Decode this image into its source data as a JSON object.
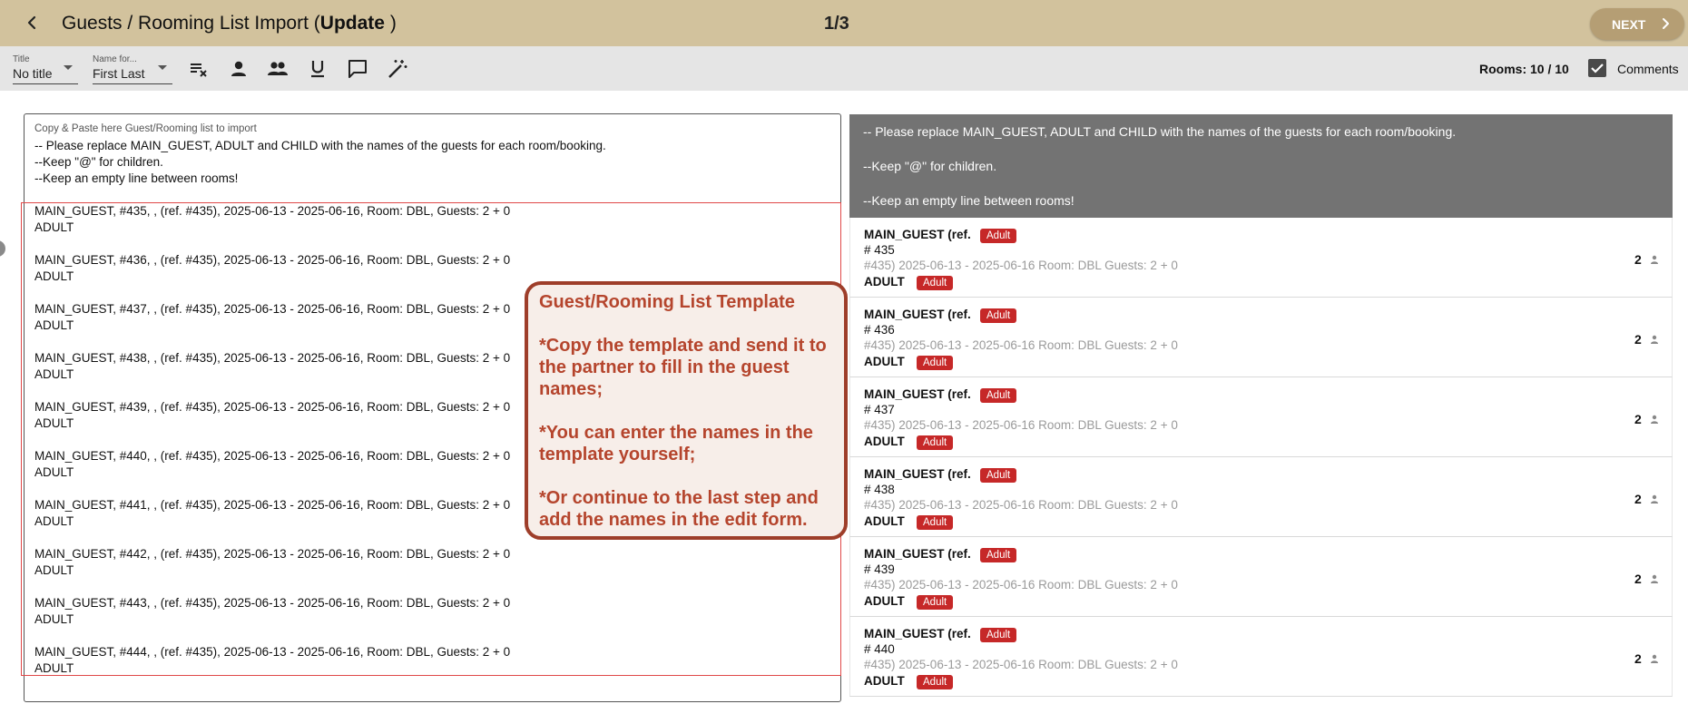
{
  "header": {
    "title_prefix": "Guests / Rooming List Import",
    "title_open": "(",
    "title_mode": "Update",
    "title_close": ")",
    "step": "1/3",
    "next_label": "NEXT"
  },
  "toolbar": {
    "title_select": {
      "label": "Title",
      "value": "No title"
    },
    "name_select": {
      "label": "Name for...",
      "value": "First Last"
    },
    "tools": [
      "clear-format-icon",
      "single-person-icon",
      "group-icon",
      "underline-icon",
      "comment-icon",
      "magic-wand-icon"
    ],
    "rooms_count": "Rooms: 10 / 10",
    "comments_label": "Comments",
    "comments_checked": true
  },
  "input": {
    "caption": "Copy & Paste here Guest/Rooming list to import",
    "intro": [
      "-- Please replace MAIN_GUEST, ADULT and CHILD with the names of the guests for each room/booking.",
      "--Keep \"@\" for children.",
      "--Keep an empty line between rooms!"
    ],
    "entries": [
      {
        "line1": "MAIN_GUEST, #435, , (ref. #435), 2025-06-13 - 2025-06-16, Room: DBL, Guests: 2 + 0",
        "line2": "ADULT"
      },
      {
        "line1": "MAIN_GUEST, #436, , (ref. #435), 2025-06-13 - 2025-06-16, Room: DBL, Guests: 2 + 0",
        "line2": "ADULT"
      },
      {
        "line1": "MAIN_GUEST, #437, , (ref. #435), 2025-06-13 - 2025-06-16, Room: DBL, Guests: 2 + 0",
        "line2": "ADULT"
      },
      {
        "line1": "MAIN_GUEST, #438, , (ref. #435), 2025-06-13 - 2025-06-16, Room: DBL, Guests: 2 + 0",
        "line2": "ADULT"
      },
      {
        "line1": "MAIN_GUEST, #439, , (ref. #435), 2025-06-13 - 2025-06-16, Room: DBL, Guests: 2 + 0",
        "line2": "ADULT"
      },
      {
        "line1": "MAIN_GUEST, #440, , (ref. #435), 2025-06-13 - 2025-06-16, Room: DBL, Guests: 2 + 0",
        "line2": "ADULT"
      },
      {
        "line1": "MAIN_GUEST, #441, , (ref. #435), 2025-06-13 - 2025-06-16, Room: DBL, Guests: 2 + 0",
        "line2": "ADULT"
      },
      {
        "line1": "MAIN_GUEST, #442, , (ref. #435), 2025-06-13 - 2025-06-16, Room: DBL, Guests: 2 + 0",
        "line2": "ADULT"
      },
      {
        "line1": "MAIN_GUEST, #443, , (ref. #435), 2025-06-13 - 2025-06-16, Room: DBL, Guests: 2 + 0",
        "line2": "ADULT"
      },
      {
        "line1": "MAIN_GUEST, #444, , (ref. #435), 2025-06-13 - 2025-06-16, Room: DBL, Guests: 2 + 0",
        "line2": "ADULT"
      }
    ]
  },
  "callout": {
    "title": "Guest/Rooming List Template",
    "points": [
      "*Copy the template and send it to the partner to fill in the guest names;",
      "*You can enter the names in the template yourself;",
      "*Or continue to the last step and add the names in the edit form."
    ]
  },
  "preview": {
    "instructions": [
      "-- Please replace MAIN_GUEST, ADULT and CHILD with the names of the guests for each room/booking.",
      "--Keep \"@\" for children.",
      "--Keep an empty line between rooms!"
    ],
    "rooms": [
      {
        "guest1": "MAIN_GUEST (ref.",
        "badge1": "Adult",
        "number": "# 435",
        "meta": "#435) 2025-06-13 - 2025-06-16 Room: DBL Guests: 2 + 0",
        "guest2": "ADULT",
        "badge2": "Adult",
        "count": "2"
      },
      {
        "guest1": "MAIN_GUEST (ref.",
        "badge1": "Adult",
        "number": "# 436",
        "meta": "#435) 2025-06-13 - 2025-06-16 Room: DBL Guests: 2 + 0",
        "guest2": "ADULT",
        "badge2": "Adult",
        "count": "2"
      },
      {
        "guest1": "MAIN_GUEST (ref.",
        "badge1": "Adult",
        "number": "# 437",
        "meta": "#435) 2025-06-13 - 2025-06-16 Room: DBL Guests: 2 + 0",
        "guest2": "ADULT",
        "badge2": "Adult",
        "count": "2"
      },
      {
        "guest1": "MAIN_GUEST (ref.",
        "badge1": "Adult",
        "number": "# 438",
        "meta": "#435) 2025-06-13 - 2025-06-16 Room: DBL Guests: 2 + 0",
        "guest2": "ADULT",
        "badge2": "Adult",
        "count": "2"
      },
      {
        "guest1": "MAIN_GUEST (ref.",
        "badge1": "Adult",
        "number": "# 439",
        "meta": "#435) 2025-06-13 - 2025-06-16 Room: DBL Guests: 2 + 0",
        "guest2": "ADULT",
        "badge2": "Adult",
        "count": "2"
      },
      {
        "guest1": "MAIN_GUEST (ref.",
        "badge1": "Adult",
        "number": "# 440",
        "meta": "#435) 2025-06-13 - 2025-06-16 Room: DBL Guests: 2 + 0",
        "guest2": "ADULT",
        "badge2": "Adult",
        "count": "2"
      }
    ]
  },
  "colors": {
    "header_bg": "#d2c29d",
    "next_button": "#b59e74",
    "toolbar_bg": "#e5e5e5",
    "instruction_bg": "#737373",
    "badge": "#c62828",
    "callout_text": "#b5452d",
    "callout_border": "#9e3e2a",
    "highlight": "#e04848"
  }
}
